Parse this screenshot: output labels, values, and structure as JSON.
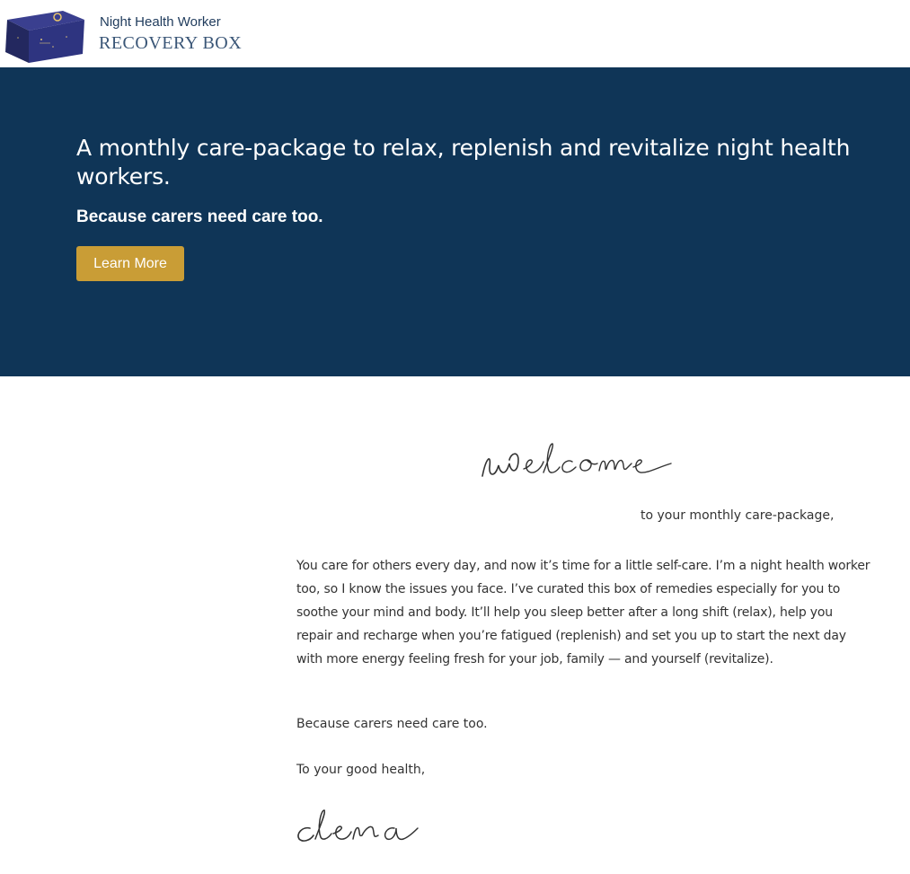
{
  "header": {
    "logo": {
      "line1": "Night Health Worker",
      "line2": "RECOVERY BOX"
    }
  },
  "hero": {
    "title": "A monthly care-package to relax, replenish and revitalize night health workers.",
    "subtitle": "Because carers need care too.",
    "cta_label": "Learn More",
    "colors": {
      "background": "#0f3557",
      "button": "#c99d36"
    }
  },
  "letter": {
    "welcome_script": "welcome",
    "greeting": "to your monthly care-package,",
    "body": "You care for others every day, and now it’s time for a little self-care. I’m a night health worker too, so I know the issues you face. I’ve curated this box of remedies especially for you to soothe your mind and body. It’ll help you sleep better after a long shift (relax), help you repair and recharge when you’re fatigued (replenish) and set you up to start the next day with more energy feeling fresh for your job, family — and yourself (revitalize).",
    "tagline": "Because carers need care too.",
    "signoff": "To your good health,",
    "signature": "elena"
  }
}
